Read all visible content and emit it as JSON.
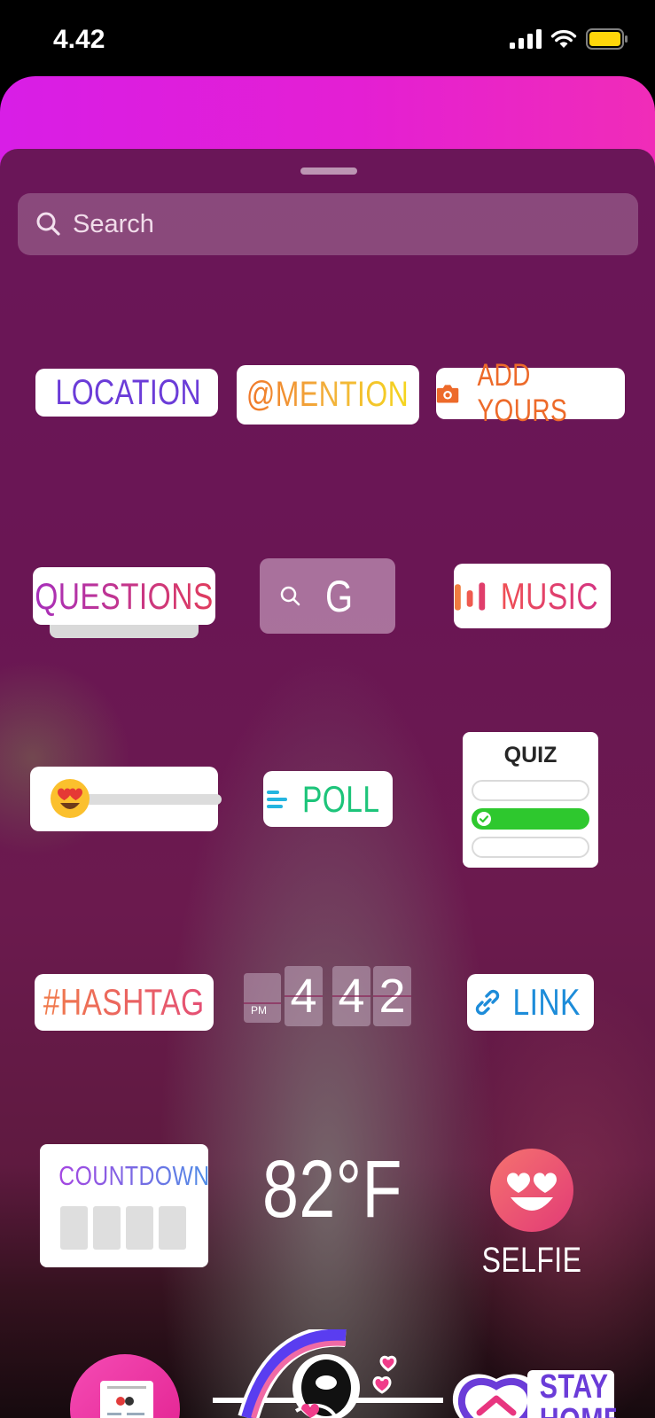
{
  "status": {
    "time": "4.42"
  },
  "search": {
    "placeholder": "Search"
  },
  "stickers": {
    "location": "LOCATION",
    "mention": "@MENTION",
    "add_yours": "ADD YOURS",
    "questions": "QUESTIONS",
    "gif_letter": "G",
    "music": "MUSIC",
    "poll": "POLL",
    "quiz": "QUIZ",
    "hashtag": "#HASHTAG",
    "clock": {
      "ampm": "PM",
      "hour": "4",
      "min1": "4",
      "min2": "2"
    },
    "link": "LINK",
    "countdown": "COUNTDOWN",
    "temperature": "82°F",
    "selfie": "SELFIE",
    "stay_home": "STAY HOME"
  },
  "colors": {
    "header_pink": "#e41fd3",
    "sheet_purple": "#6a1658",
    "quiz_green": "#2ec82e",
    "battery_yellow": "#ffd60a"
  }
}
